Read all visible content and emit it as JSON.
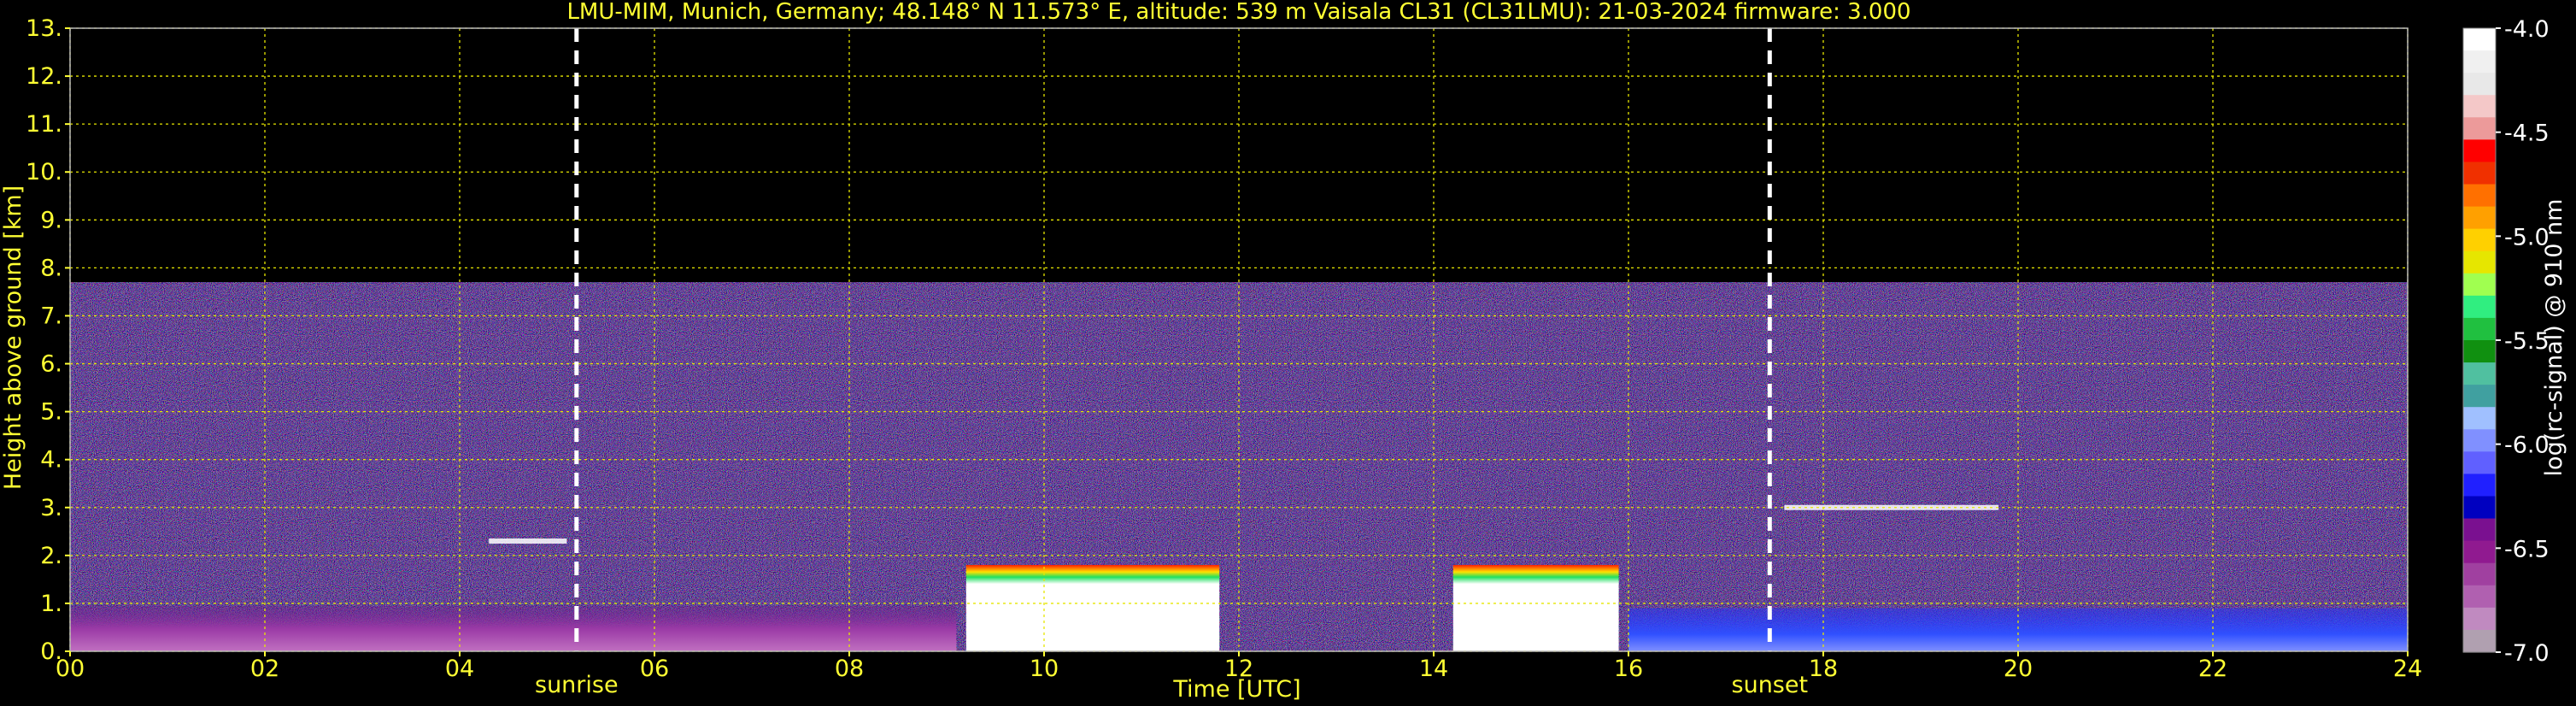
{
  "chart_data": {
    "type": "heatmap",
    "title": "LMU-MIM, Munich, Germany; 48.148° N 11.573° E, altitude: 539 m    Vaisala CL31 (CL31LMU): 21-03-2024    firmware: 3.000",
    "xlabel": "Time [UTC]",
    "ylabel": "Height above ground [km]",
    "xlim": [
      0,
      24
    ],
    "ylim": [
      0,
      13
    ],
    "x_ticks": [
      "00",
      "02",
      "04",
      "06",
      "08",
      "10",
      "12",
      "14",
      "16",
      "18",
      "20",
      "22",
      "24"
    ],
    "y_ticks": [
      "0.",
      "1.",
      "2.",
      "3.",
      "4.",
      "5.",
      "6.",
      "7.",
      "8.",
      "9.",
      "10.",
      "11.",
      "12.",
      "13."
    ],
    "grid": true,
    "events": [
      {
        "label": "sunrise",
        "time": 5.2
      },
      {
        "label": "sunset",
        "time": 17.45
      }
    ],
    "signal_top_km": 7.7,
    "colorbar": {
      "label": "log(rc-signal) @ 910 nm",
      "min": -7.0,
      "max": -4.0,
      "ticks": [
        "-4.0",
        "-4.5",
        "-5.0",
        "-5.5",
        "-6.0",
        "-6.5",
        "-7.0"
      ],
      "colors": [
        "#ffffff",
        "#f0f0f0",
        "#e8e8e8",
        "#f4c8c8",
        "#ec9a9a",
        "#ff0000",
        "#f03000",
        "#ff7000",
        "#ffa000",
        "#ffd000",
        "#e6e600",
        "#a0ff50",
        "#30ee80",
        "#20c040",
        "#109010",
        "#50c0a0",
        "#40a0a0",
        "#a0c0ff",
        "#8090ff",
        "#6060ff",
        "#2020ff",
        "#0000c0",
        "#7a1090",
        "#901a90",
        "#a040a0",
        "#b060b0",
        "#c08ac0",
        "#b0a0b0"
      ]
    },
    "features": [
      {
        "kind": "boundary_layer",
        "t0": 0,
        "t1": 9.1,
        "h0": 0,
        "h1": 0.95
      },
      {
        "kind": "cloud",
        "t0": 9.2,
        "t1": 11.8,
        "h0": 0,
        "h1": 1.8
      },
      {
        "kind": "cloud",
        "t0": 14.2,
        "t1": 15.9,
        "h0": 0,
        "h1": 1.8
      },
      {
        "kind": "thin_layer",
        "t0": 17.6,
        "t1": 19.8,
        "h": 3.0
      },
      {
        "kind": "thin_layer",
        "t0": 4.3,
        "t1": 5.1,
        "h": 2.3
      },
      {
        "kind": "aerosol",
        "t0": 16.0,
        "t1": 24,
        "h0": 0,
        "h1": 0.9
      }
    ]
  }
}
